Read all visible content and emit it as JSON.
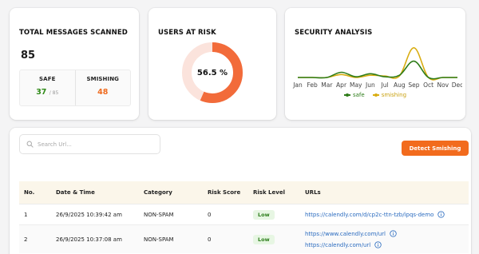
{
  "total_card": {
    "title": "TOTAL MESSAGES SCANNED",
    "total": "85",
    "safe_label": "SAFE",
    "safe_value": "37",
    "safe_sub": "/ 85",
    "smishing_label": "SMISHING",
    "smishing_value": "48"
  },
  "risk_card": {
    "title": "USERS AT RISK",
    "percent_label": "56.5 %",
    "risk_fraction": 0.565,
    "colors": {
      "risk": "#f26b3a",
      "rest": "#fbe3dc"
    }
  },
  "analysis_card": {
    "title": "SECURITY ANALYSIS",
    "legend": {
      "safe": "safe",
      "smishing": "smishing"
    }
  },
  "chart_data": {
    "type": "line",
    "categories": [
      "Jan",
      "Feb",
      "Mar",
      "Apr",
      "May",
      "Jun",
      "Jul",
      "Aug",
      "Sep",
      "Oct",
      "Nov",
      "Dec"
    ],
    "series": [
      {
        "name": "safe",
        "color": "#2f7d1a",
        "values": [
          0,
          0,
          0,
          7,
          1,
          5,
          1,
          3,
          22,
          0,
          0,
          0
        ]
      },
      {
        "name": "smishing",
        "color": "#d9ad12",
        "values": [
          0,
          0,
          0,
          4,
          0,
          3,
          2,
          2,
          40,
          0,
          0,
          0
        ]
      }
    ],
    "ylim": [
      0,
      42
    ],
    "grid": false,
    "legend_position": "bottom"
  },
  "toolbar": {
    "search_placeholder": "Search Url...",
    "detect_label": "Detect Smishing"
  },
  "table": {
    "headers": [
      "No.",
      "Date & Time",
      "Category",
      "Risk Score",
      "Risk Level",
      "URLs"
    ],
    "rows": [
      {
        "no": "1",
        "datetime": "26/9/2025 10:39:42 am",
        "category": "NON-SPAM",
        "score": "0",
        "level": "Low",
        "urls": [
          "https://calendly.com/d/cp2c-ttn-tzb/ipqs-demo"
        ]
      },
      {
        "no": "2",
        "datetime": "26/9/2025 10:37:08 am",
        "category": "NON-SPAM",
        "score": "0",
        "level": "Low",
        "urls": [
          "https://www.calendly.com/url",
          "https://calendly.com/url"
        ]
      }
    ]
  }
}
